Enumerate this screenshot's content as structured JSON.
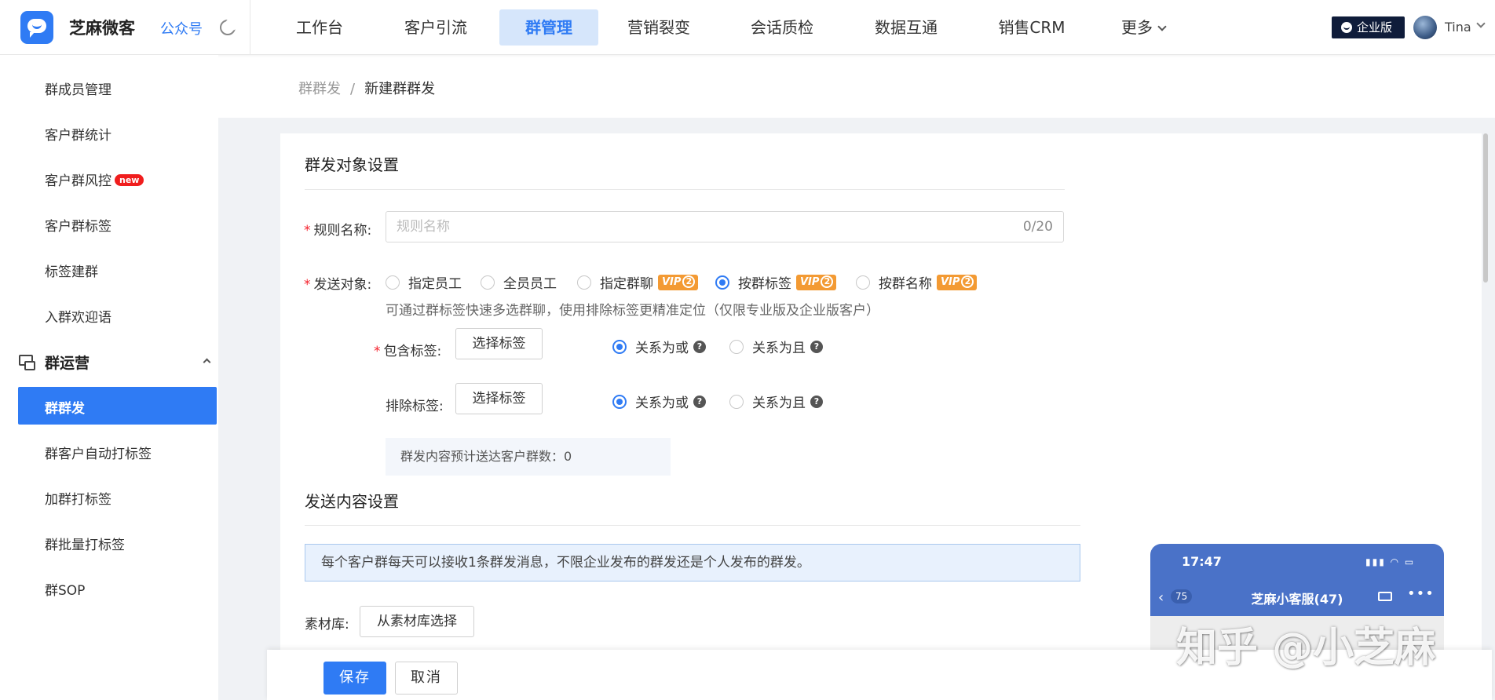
{
  "header": {
    "brand": "芝麻微客",
    "gzh_link": "公众号",
    "nav": [
      {
        "label": "工作台"
      },
      {
        "label": "客户引流"
      },
      {
        "label": "群管理"
      },
      {
        "label": "营销裂变"
      },
      {
        "label": "会话质检"
      },
      {
        "label": "数据互通"
      },
      {
        "label": "销售CRM"
      },
      {
        "label": "更多"
      }
    ],
    "active_nav": "群管理",
    "edition_badge": "企业版",
    "username": "Tina"
  },
  "sidebar": {
    "items": [
      {
        "label": "群成员管理"
      },
      {
        "label": "客户群统计"
      },
      {
        "label": "客户群风控",
        "badge": "new"
      },
      {
        "label": "客户群标签"
      },
      {
        "label": "标签建群"
      },
      {
        "label": "入群欢迎语"
      }
    ],
    "group": {
      "label": "群运营"
    },
    "group_items": [
      {
        "label": "群群发",
        "active": true
      },
      {
        "label": "群客户自动打标签"
      },
      {
        "label": "加群打标签"
      },
      {
        "label": "群批量打标签"
      },
      {
        "label": "群SOP"
      }
    ]
  },
  "breadcrumb": {
    "parent": "群群发",
    "separator": "/",
    "current": "新建群群发"
  },
  "form": {
    "section1_title": "群发对象设置",
    "rule_name_label": "规则名称:",
    "rule_name_placeholder": "规则名称",
    "rule_name_count": "0/20",
    "target_label": "发送对象:",
    "target_options": [
      {
        "label": "指定员工",
        "vip": false,
        "checked": false
      },
      {
        "label": "全员员工",
        "vip": false,
        "checked": false
      },
      {
        "label": "指定群聊",
        "vip": true,
        "checked": false
      },
      {
        "label": "按群标签",
        "vip": true,
        "checked": true
      },
      {
        "label": "按群名称",
        "vip": true,
        "checked": false
      }
    ],
    "vip_text": "VIP",
    "vip_level": "2",
    "target_hint": "可通过群标签快速多选群聊，使用排除标签更精准定位（仅限专业版及企业版客户）",
    "include_label": "包含标签:",
    "exclude_label": "排除标签:",
    "select_tag_btn": "选择标签",
    "relation_or": "关系为或",
    "relation_and": "关系为且",
    "estimate_text": "群发内容预计送达客户群数：0",
    "section2_title": "发送内容设置",
    "notice": "每个客户群每天可以接收1条群发消息，不限企业发布的群发还是个人发布的群发。",
    "material_label": "素材库:",
    "material_btn": "从素材库选择"
  },
  "phone": {
    "time": "17:47",
    "back_count": "75",
    "chat_title": "芝麻小客服(47)"
  },
  "watermark": "知乎 @小芝麻",
  "footer": {
    "save": "保存",
    "cancel": "取消"
  },
  "colors": {
    "primary": "#2f7bf4",
    "vip": "#f39a33",
    "required": "#f5222d",
    "edition_badge_bg": "#0f1c3a"
  }
}
